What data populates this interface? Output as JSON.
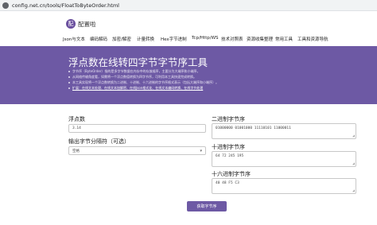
{
  "browser": {
    "url": "config.net.cn/tools/FloatToByteOrder.html"
  },
  "header": {
    "logo_char": "配",
    "logo_text": "配置啦",
    "nav": [
      "Json与文本",
      "编码解码",
      "加密/解密",
      "计量转换",
      "Hex字节进制",
      "Tcp/Http/WS",
      "技术对照表",
      "资源收集整理",
      "常用工具",
      "工具和资源导航"
    ]
  },
  "hero": {
    "title": "浮点数在线转四字节字节序工具",
    "bullets": [
      "字节序（ByteOrder）指的是多字节数据在内存中的存放顺序，主要分为大端序和小端序。",
      "从网络传输角度看，如需将一个浮点数值转换为四字节序，可利用本工具快速完成转换。",
      "本工具实现将一个浮点数转换为二进制、十进制、十六进制的字节序格式表示（包括大端序和小端序）。"
    ],
    "links": "扩展：在线文本处理、在线文本加解密、在线Json格式化、在线文本编码转换、在线字节处理"
  },
  "form": {
    "float_label": "浮点数",
    "float_value": "3.14",
    "sep_label": "输出字节分隔符（可选）",
    "sep_value": "空格",
    "binary_label": "二进制字节序",
    "binary_value": "01000000 01001000 11110101 11000011",
    "decimal_label": "十进制字节序",
    "decimal_value": "64 72 245 195",
    "hex_label": "十六进制字节序",
    "hex_value": "40 48 F5 C3",
    "convert_label": "获取字节序"
  },
  "colors": {
    "hero_bg": "#6d59a4",
    "button_bg": "#6d59a4"
  }
}
